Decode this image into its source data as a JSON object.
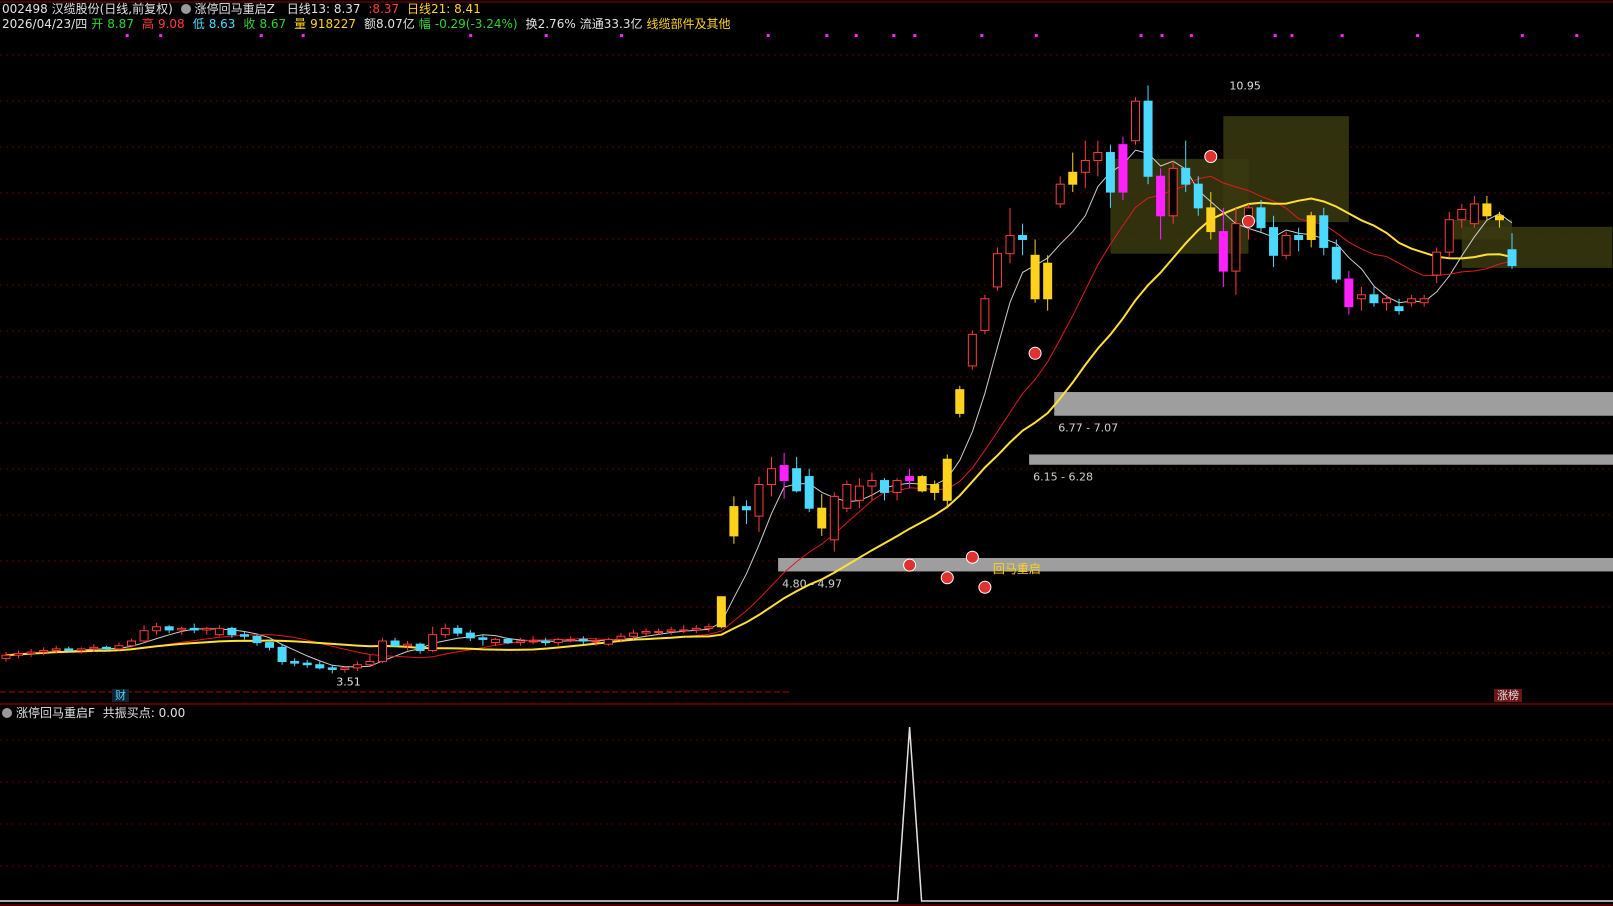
{
  "header": {
    "stock_title": "002498 汉缆股份(日线,前复权)",
    "indicator_main": "涨停回马重启Z",
    "ma13_label": "日线13: 8.37",
    "ma13_extra": ":8.37",
    "ma21_label": "日线21: 8.41",
    "date": "2026/04/23/四",
    "open_label": "开",
    "open_value": "8.87",
    "high_label": "高",
    "high_value": "9.08",
    "low_label": "低",
    "low_value": "8.63",
    "close_label": "收",
    "close_value": "8.67",
    "volume_label": "量",
    "volume_value": "918227",
    "amount": "额8.07亿",
    "change_label": "幅",
    "change_value": "-0.29(-3.24%)",
    "turnover": "换2.76%",
    "float_cap": "流通33.3亿",
    "sector": "线缆部件及其他"
  },
  "sub_indicator": {
    "title": "涨停回马重启F",
    "value_label": "共振买点: 0.00"
  },
  "labels": {
    "high_annotation": "10.95",
    "low_annotation": "3.51",
    "restart": "回马重启",
    "fin": "财",
    "limit_rank": "涨榜"
  },
  "colors": {
    "up": "#ff3c3c",
    "down": "#4dd9ff",
    "limit_up": "#ffd21e",
    "special": "#ff22ff",
    "ma13": "#e01a1a",
    "ma21": "#ffe033",
    "ma_white": "#cccccc",
    "zone_gray": "#9e9e9e"
  },
  "chart_data": {
    "type": "candlestick",
    "candles": [
      [
        3.7,
        3.78,
        3.66,
        3.74
      ],
      [
        3.74,
        3.8,
        3.7,
        3.76
      ],
      [
        3.76,
        3.82,
        3.72,
        3.78
      ],
      [
        3.78,
        3.84,
        3.74,
        3.8
      ],
      [
        3.8,
        3.86,
        3.76,
        3.82
      ],
      [
        3.82,
        3.85,
        3.78,
        3.8
      ],
      [
        3.8,
        3.84,
        3.76,
        3.82
      ],
      [
        3.82,
        3.88,
        3.78,
        3.84
      ],
      [
        3.84,
        3.86,
        3.8,
        3.82
      ],
      [
        3.82,
        3.9,
        3.8,
        3.86
      ],
      [
        3.86,
        3.95,
        3.84,
        3.92
      ],
      [
        3.92,
        4.12,
        3.9,
        4.05
      ],
      [
        4.05,
        4.15,
        4.0,
        4.1
      ],
      [
        4.1,
        4.12,
        4.02,
        4.06
      ],
      [
        4.06,
        4.1,
        4.0,
        4.08
      ],
      [
        4.08,
        4.14,
        4.02,
        4.06
      ],
      [
        4.06,
        4.1,
        4.0,
        4.08
      ],
      [
        4.0,
        4.12,
        3.98,
        4.08
      ],
      [
        4.08,
        4.1,
        3.96,
        4.0
      ],
      [
        4.0,
        4.04,
        3.94,
        3.98
      ],
      [
        3.98,
        4.0,
        3.86,
        3.9
      ],
      [
        3.9,
        3.94,
        3.8,
        3.84
      ],
      [
        3.84,
        3.88,
        3.62,
        3.66
      ],
      [
        3.66,
        3.7,
        3.6,
        3.64
      ],
      [
        3.64,
        3.68,
        3.58,
        3.62
      ],
      [
        3.62,
        3.66,
        3.56,
        3.58
      ],
      [
        3.58,
        3.62,
        3.51,
        3.56
      ],
      [
        3.56,
        3.6,
        3.52,
        3.58
      ],
      [
        3.58,
        3.66,
        3.54,
        3.62
      ],
      [
        3.62,
        3.74,
        3.6,
        3.66
      ],
      [
        3.66,
        3.96,
        3.64,
        3.92
      ],
      [
        3.92,
        3.96,
        3.84,
        3.86
      ],
      [
        3.86,
        3.92,
        3.8,
        3.88
      ],
      [
        3.88,
        3.9,
        3.76,
        3.8
      ],
      [
        3.8,
        4.1,
        3.78,
        4.0
      ],
      [
        4.0,
        4.14,
        3.96,
        4.08
      ],
      [
        4.08,
        4.12,
        3.98,
        4.02
      ],
      [
        4.02,
        4.06,
        3.92,
        3.96
      ],
      [
        3.96,
        4.0,
        3.86,
        3.94
      ],
      [
        3.9,
        3.96,
        3.86,
        3.94
      ],
      [
        3.94,
        3.96,
        3.88,
        3.9
      ],
      [
        3.9,
        3.96,
        3.86,
        3.92
      ],
      [
        3.92,
        3.98,
        3.88,
        3.92
      ],
      [
        3.92,
        3.96,
        3.86,
        3.9
      ],
      [
        3.9,
        3.96,
        3.86,
        3.94
      ],
      [
        3.94,
        3.98,
        3.9,
        3.94
      ],
      [
        3.94,
        3.98,
        3.88,
        3.92
      ],
      [
        3.92,
        3.96,
        3.86,
        3.92
      ],
      [
        3.88,
        3.96,
        3.86,
        3.94
      ],
      [
        3.94,
        4.02,
        3.9,
        3.98
      ],
      [
        3.98,
        4.06,
        3.94,
        4.02
      ],
      [
        4.02,
        4.08,
        3.98,
        4.04
      ],
      [
        4.04,
        4.08,
        4.0,
        4.04
      ],
      [
        4.04,
        4.1,
        4.0,
        4.06
      ],
      [
        4.06,
        4.12,
        4.02,
        4.06
      ],
      [
        4.06,
        4.12,
        4.02,
        4.08
      ],
      [
        4.08,
        4.14,
        4.04,
        4.1
      ],
      [
        4.1,
        4.48,
        4.08,
        4.48
      ],
      [
        5.25,
        5.75,
        5.15,
        5.62
      ],
      [
        5.62,
        5.7,
        5.4,
        5.58
      ],
      [
        5.5,
        6.0,
        5.3,
        5.9
      ],
      [
        5.9,
        6.25,
        5.75,
        6.1
      ],
      [
        5.95,
        6.3,
        5.72,
        6.14
      ],
      [
        6.1,
        6.25,
        5.8,
        5.82
      ],
      [
        6.0,
        6.1,
        5.55,
        5.6
      ],
      [
        5.6,
        5.78,
        5.25,
        5.35
      ],
      [
        5.2,
        5.8,
        5.05,
        5.75
      ],
      [
        5.6,
        5.95,
        5.55,
        5.9
      ],
      [
        5.7,
        5.98,
        5.6,
        5.88
      ],
      [
        5.88,
        6.05,
        5.7,
        5.95
      ],
      [
        5.95,
        5.98,
        5.7,
        5.8
      ],
      [
        5.8,
        5.98,
        5.7,
        5.95
      ],
      [
        5.95,
        6.1,
        5.85,
        6.0
      ],
      [
        6.0,
        6.02,
        5.8,
        5.82
      ],
      [
        5.8,
        5.95,
        5.7,
        5.9
      ],
      [
        5.7,
        6.28,
        5.6,
        6.22
      ],
      [
        6.8,
        7.15,
        6.75,
        7.1
      ],
      [
        7.4,
        7.85,
        7.35,
        7.8
      ],
      [
        7.85,
        8.3,
        7.8,
        8.25
      ],
      [
        8.4,
        8.9,
        8.35,
        8.82
      ],
      [
        8.82,
        9.4,
        8.7,
        9.05
      ],
      [
        9.05,
        9.2,
        8.8,
        9.0
      ],
      [
        8.8,
        9.0,
        8.2,
        8.25
      ],
      [
        8.25,
        8.8,
        8.1,
        8.7
      ],
      [
        9.45,
        9.8,
        9.4,
        9.7
      ],
      [
        9.7,
        10.1,
        9.6,
        9.85
      ],
      [
        9.85,
        10.25,
        9.65,
        10.0
      ],
      [
        10.0,
        10.25,
        9.8,
        10.1
      ],
      [
        10.1,
        10.2,
        9.4,
        9.6
      ],
      [
        9.6,
        10.3,
        9.5,
        10.2
      ],
      [
        10.25,
        10.8,
        10.2,
        10.75
      ],
      [
        10.75,
        10.95,
        9.7,
        9.8
      ],
      [
        9.8,
        9.9,
        9.0,
        9.3
      ],
      [
        9.3,
        10.0,
        9.2,
        9.9
      ],
      [
        9.9,
        10.25,
        9.6,
        9.7
      ],
      [
        9.7,
        9.8,
        9.3,
        9.4
      ],
      [
        9.4,
        9.6,
        9.0,
        9.1
      ],
      [
        9.1,
        9.4,
        8.4,
        8.6
      ],
      [
        8.6,
        9.4,
        8.3,
        9.2
      ],
      [
        9.2,
        9.45,
        9.0,
        9.4
      ],
      [
        9.4,
        9.5,
        9.1,
        9.15
      ],
      [
        9.15,
        9.3,
        8.65,
        8.8
      ],
      [
        8.8,
        9.1,
        8.75,
        9.05
      ],
      [
        9.05,
        9.15,
        8.85,
        9.0
      ],
      [
        9.0,
        9.35,
        8.9,
        9.3
      ],
      [
        9.3,
        9.4,
        8.8,
        8.9
      ],
      [
        8.9,
        9.0,
        8.45,
        8.5
      ],
      [
        8.5,
        8.6,
        8.05,
        8.15
      ],
      [
        8.25,
        8.4,
        8.1,
        8.3
      ],
      [
        8.3,
        8.4,
        8.15,
        8.2
      ],
      [
        8.2,
        8.3,
        8.1,
        8.25
      ],
      [
        8.15,
        8.25,
        8.05,
        8.1
      ],
      [
        8.2,
        8.3,
        8.15,
        8.25
      ],
      [
        8.2,
        8.3,
        8.15,
        8.25
      ],
      [
        8.55,
        8.9,
        8.45,
        8.84
      ],
      [
        8.84,
        9.35,
        8.78,
        9.25
      ],
      [
        9.25,
        9.45,
        9.15,
        9.38
      ],
      [
        9.2,
        9.55,
        9.15,
        9.45
      ],
      [
        9.45,
        9.55,
        9.25,
        9.3
      ],
      [
        9.3,
        9.35,
        9.15,
        9.25
      ],
      [
        8.87,
        9.08,
        8.63,
        8.67
      ]
    ],
    "limit_up_indices": [
      57,
      58,
      65,
      73,
      74,
      75,
      76,
      82,
      83,
      85,
      96,
      104,
      118,
      119
    ],
    "special_indices": [
      62,
      72,
      82,
      83,
      89,
      92,
      97,
      107
    ],
    "ma13_values": "computed from closes",
    "ylim": [
      3.3,
      11.6
    ],
    "price_zones": [
      {
        "low": 4.8,
        "high": 4.97,
        "label": "4.80 - 4.97"
      },
      {
        "low": 6.15,
        "high": 6.28,
        "label": "6.15 - 6.28"
      },
      {
        "low": 6.77,
        "high": 7.07,
        "label": "6.77 - 7.07"
      }
    ],
    "high_point": 10.95,
    "low_point": 3.51,
    "sub_indicator_peak_index": 72,
    "sub_indicator_value": 0.0
  }
}
